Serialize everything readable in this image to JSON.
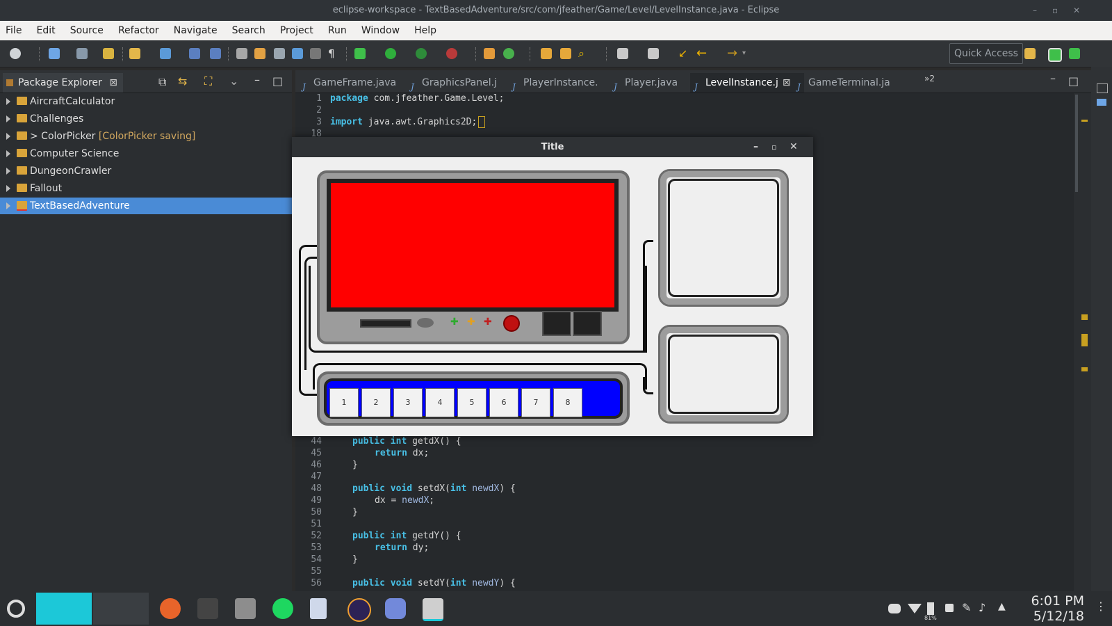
{
  "window": {
    "title": "eclipse-workspace - TextBasedAdventure/src/com/jfeather/Game/Level/LevelInstance.java - Eclipse"
  },
  "menu": [
    "File",
    "Edit",
    "Source",
    "Refactor",
    "Navigate",
    "Search",
    "Project",
    "Run",
    "Window",
    "Help"
  ],
  "toolbar": {
    "quick_access": "Quick Access"
  },
  "package_explorer": {
    "title": "Package Explorer",
    "items": [
      {
        "label": "AircraftCalculator",
        "deco": ""
      },
      {
        "label": "Challenges",
        "deco": ""
      },
      {
        "label": "> ColorPicker",
        "deco": "[ColorPicker saving]"
      },
      {
        "label": "Computer Science",
        "deco": ""
      },
      {
        "label": "DungeonCrawler",
        "deco": ""
      },
      {
        "label": "Fallout",
        "deco": ""
      },
      {
        "label": "TextBasedAdventure",
        "deco": ""
      }
    ]
  },
  "editor_tabs": [
    "GameFrame.java",
    "GraphicsPanel.j",
    "PlayerInstance.",
    "Player.java",
    "LevelInstance.j",
    "GameTerminal.ja"
  ],
  "editor_overflow": "»2",
  "code_top": [
    {
      "n": "1",
      "text": "package com.jfeather.Game.Level;"
    },
    {
      "n": "2",
      "text": ""
    },
    {
      "n": "3",
      "text": "import java.awt.Graphics2D;"
    },
    {
      "n": "18",
      "text": ""
    }
  ],
  "code_bottom": [
    {
      "n": "44",
      "kw": "public int",
      "text": " getdX() {"
    },
    {
      "n": "45",
      "kw": "return",
      "text": " dx;",
      "indent": true
    },
    {
      "n": "46",
      "kw": "",
      "text": "}"
    },
    {
      "n": "47",
      "kw": "",
      "text": ""
    },
    {
      "n": "48",
      "kw": "public void",
      "text": " setdX(int newdX) {"
    },
    {
      "n": "49",
      "kw": "",
      "text": "dx = newdX;",
      "indent": true
    },
    {
      "n": "50",
      "kw": "",
      "text": "}"
    },
    {
      "n": "51",
      "kw": "",
      "text": ""
    },
    {
      "n": "52",
      "kw": "public int",
      "text": " getdY() {"
    },
    {
      "n": "53",
      "kw": "return",
      "text": " dy;",
      "indent": true
    },
    {
      "n": "54",
      "kw": "",
      "text": "}"
    },
    {
      "n": "55",
      "kw": "",
      "text": ""
    },
    {
      "n": "56",
      "kw": "public void",
      "text": " setdY(int newdY) {"
    }
  ],
  "game_window": {
    "title": "Title",
    "hotbar_slots": [
      "1",
      "2",
      "3",
      "4",
      "5",
      "6",
      "7",
      "8"
    ]
  },
  "taskbar": {
    "time": "6:01 PM",
    "date": "5/12/18",
    "battery": "81%"
  },
  "colors": {
    "accent_selection": "#4a8bd6",
    "game_screen": "#ff0000",
    "hotbar": "#0000ff"
  }
}
